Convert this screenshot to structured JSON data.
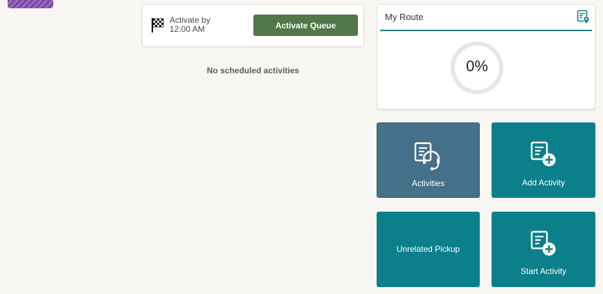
{
  "activate": {
    "line1": "Activate by",
    "line2": "12:00 AM",
    "button_label": "Activate Queue"
  },
  "main": {
    "empty_message": "No scheduled activities"
  },
  "route": {
    "title": "My Route",
    "progress_text": "0%",
    "progress": 0
  },
  "tiles": {
    "activities": "Activities",
    "add_activity": "Add Activity",
    "unrelated_pickup": "Unrelated Pickup",
    "start_activity": "Start Activity"
  },
  "icons": {
    "flag": "checkered-flag-icon",
    "route": "route-map-pin-icon",
    "activities": "activities-headset-icon",
    "add_activity": "add-activity-icon",
    "start_activity": "start-activity-icon"
  },
  "colors": {
    "background": "#f9f7f3",
    "activate_button": "#527849",
    "accent_teal": "#0b808b",
    "activities_tile": "#45708a",
    "route_divider": "#1d7a7b"
  }
}
